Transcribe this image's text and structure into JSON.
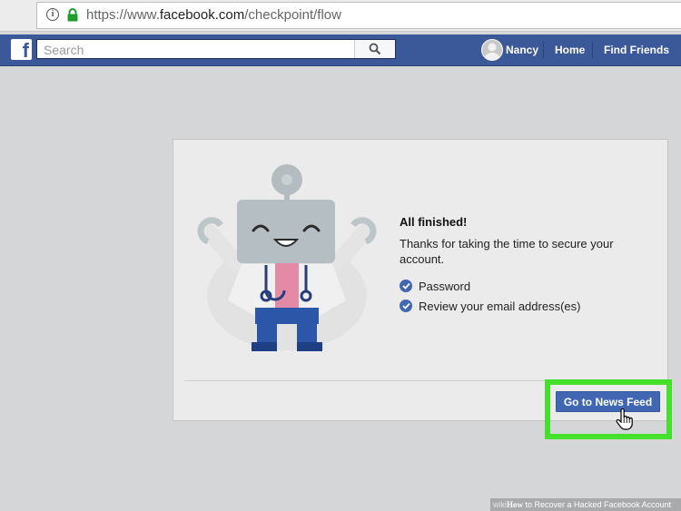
{
  "browser": {
    "url_prefix": "https://www.",
    "url_domain": "facebook.com",
    "url_path": "/checkpoint/flow"
  },
  "header": {
    "search_placeholder": "Search",
    "user_name": "Nancy",
    "home": "Home",
    "find_friends": "Find Friends"
  },
  "card": {
    "title": "All finished!",
    "message": "Thanks for taking the time to secure your account.",
    "items": [
      "Password",
      "Review your email address(es)"
    ],
    "button": "Go to News Feed"
  },
  "footer": {
    "brand": "wiki",
    "how": "How",
    "text": " to Recover a Hacked Facebook Account"
  },
  "colors": {
    "facebook_blue": "#3b5998",
    "button_blue": "#4267b2",
    "highlight_green": "#45e02b"
  }
}
